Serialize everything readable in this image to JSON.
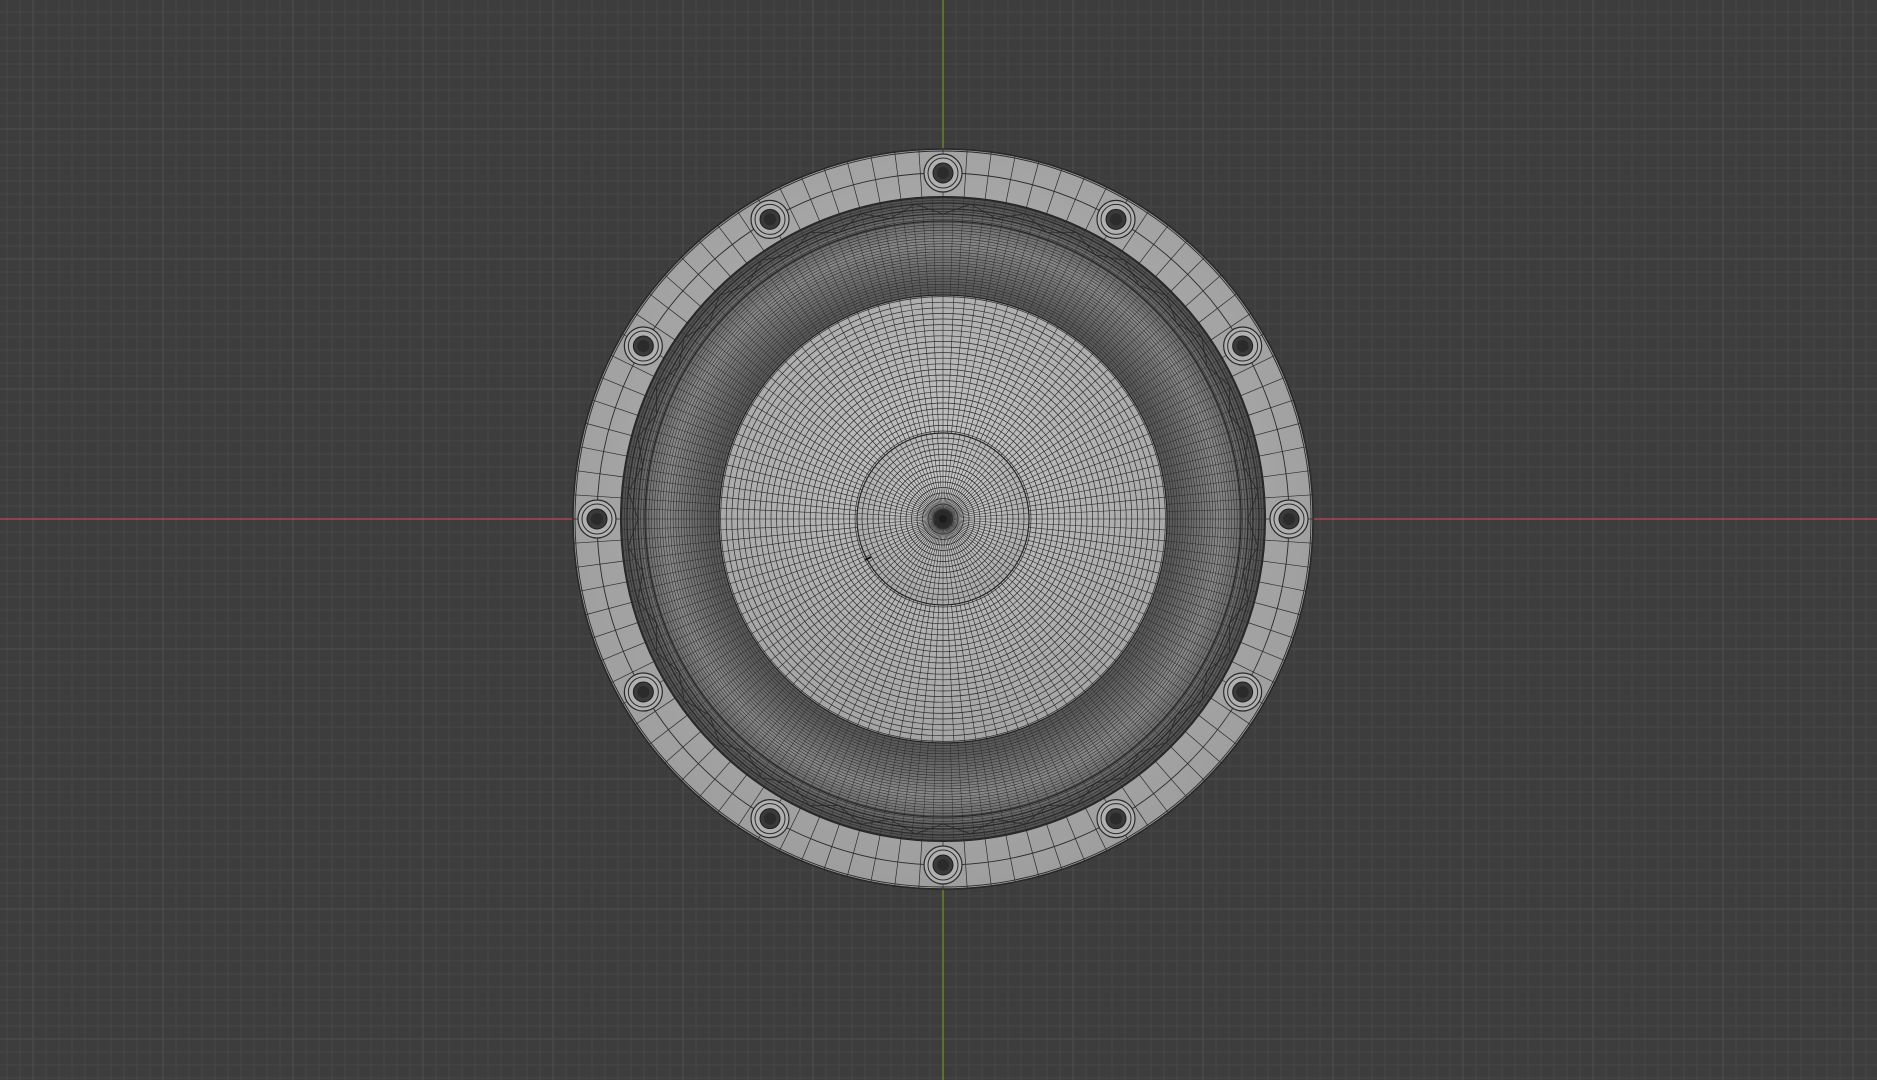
{
  "viewport": {
    "mode": "orthographic-front-wireframe",
    "background_color": "#3d3d3d",
    "grid": {
      "minor_color": "#474747",
      "major_color": "#4f4f4f"
    },
    "axes": {
      "x_axis_color": "#c0455a",
      "z_axis_color": "#6b8e2b"
    }
  },
  "model": {
    "object": "speaker-driver",
    "mesh_color": "#a9a9a9",
    "wire_color": "#2a2a2a",
    "mounting_bolts": 12,
    "flange_segments": 96,
    "surround_segments": 96,
    "cone_segments": 64,
    "dust_cap_segments": 48
  }
}
